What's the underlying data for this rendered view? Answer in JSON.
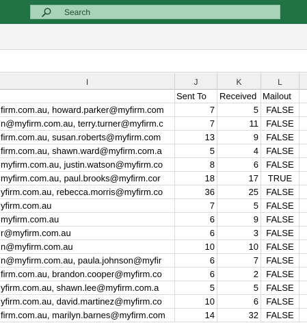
{
  "search": {
    "placeholder": "Search",
    "icon": "search-icon"
  },
  "columns": [
    "I",
    "J",
    "K",
    "L"
  ],
  "header_row": {
    "col_j": "Sent To",
    "col_k": "Received",
    "col_l": "Mailout"
  },
  "rows": [
    {
      "i": "firm.com.au, howard.parker@myfirm.com",
      "j": "7",
      "k": "5",
      "l": "FALSE"
    },
    {
      "i": "n@myfirm.com.au, terry.turner@myfirm.c",
      "j": "7",
      "k": "11",
      "l": "FALSE"
    },
    {
      "i": "firm.com.au, susan.roberts@myfirm.com",
      "j": "13",
      "k": "9",
      "l": "FALSE"
    },
    {
      "i": "firm.com.au, shawn.ward@myfirm.com.a",
      "j": "5",
      "k": "4",
      "l": "FALSE"
    },
    {
      "i": "myfirm.com.au, justin.watson@myfirm.co",
      "j": "8",
      "k": "6",
      "l": "FALSE"
    },
    {
      "i": "myfirm.com.au, paul.brooks@myfirm.cor",
      "j": "18",
      "k": "17",
      "l": "TRUE"
    },
    {
      "i": "yfirm.com.au, rebecca.morris@myfirm.co",
      "j": "36",
      "k": "25",
      "l": "FALSE"
    },
    {
      "i": "yfirm.com.au",
      "j": "7",
      "k": "5",
      "l": "FALSE"
    },
    {
      "i": "myfirm.com.au",
      "j": "6",
      "k": "9",
      "l": "FALSE"
    },
    {
      "i": "r@myfirm.com.au",
      "j": "6",
      "k": "3",
      "l": "FALSE"
    },
    {
      "i": "n@myfirm.com.au",
      "j": "10",
      "k": "10",
      "l": "FALSE"
    },
    {
      "i": "n@myfirm.com.au, paula.johnson@myfir",
      "j": "6",
      "k": "7",
      "l": "FALSE"
    },
    {
      "i": "firm.com.au, brandon.cooper@myfirm.co",
      "j": "6",
      "k": "2",
      "l": "FALSE"
    },
    {
      "i": "yfirm.com.au, shawn.lee@myfirm.com.a",
      "j": "5",
      "k": "5",
      "l": "FALSE"
    },
    {
      "i": "yfirm.com.au, david.martinez@myfirm.co",
      "j": "10",
      "k": "6",
      "l": "FALSE"
    },
    {
      "i": "firm.com.au, marilyn.barnes@myfirm.com",
      "j": "14",
      "k": "32",
      "l": "FALSE"
    }
  ]
}
